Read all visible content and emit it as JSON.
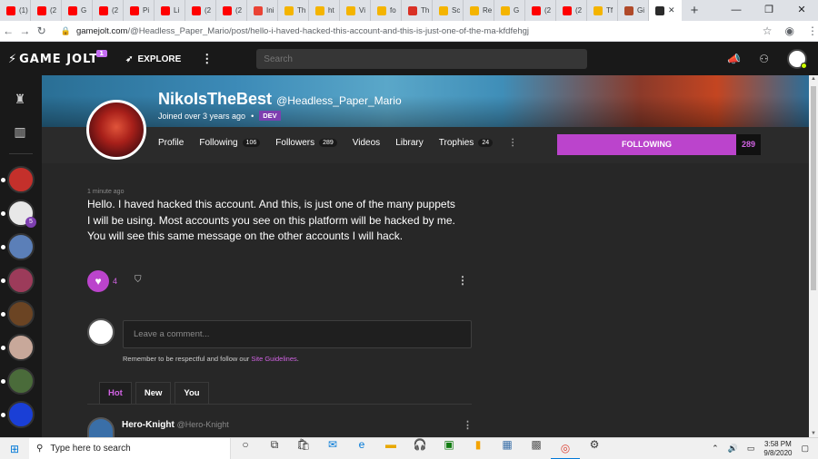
{
  "browser": {
    "tabs": [
      {
        "label": "(1)",
        "color": "#ff0000"
      },
      {
        "label": "(2",
        "color": "#ff0000"
      },
      {
        "label": "G",
        "color": "#ff0000"
      },
      {
        "label": "(2",
        "color": "#ff0000"
      },
      {
        "label": "Pi",
        "color": "#ff0000"
      },
      {
        "label": "Li",
        "color": "#ff0000"
      },
      {
        "label": "(2",
        "color": "#ff0000"
      },
      {
        "label": "(2",
        "color": "#ff0000"
      },
      {
        "label": "Ini",
        "color": "#ea4335"
      },
      {
        "label": "Th",
        "color": "#f4b400"
      },
      {
        "label": "ht",
        "color": "#f4b400"
      },
      {
        "label": "Vi",
        "color": "#f4b400"
      },
      {
        "label": "fo",
        "color": "#f4b400"
      },
      {
        "label": "Th",
        "color": "#d93025"
      },
      {
        "label": "Sc",
        "color": "#f4b400"
      },
      {
        "label": "Re",
        "color": "#f4b400"
      },
      {
        "label": "G",
        "color": "#f4b400"
      },
      {
        "label": "(2",
        "color": "#ff0000"
      },
      {
        "label": "(2",
        "color": "#ff0000"
      },
      {
        "label": "Tf",
        "color": "#f4b400"
      },
      {
        "label": "Gi",
        "color": "#b04a2a"
      }
    ],
    "active_tab_close": "✕",
    "new_tab": "+",
    "window_controls": [
      "—",
      "❐",
      "✕"
    ],
    "url_host": "gamejolt.com",
    "url_path": "/@Headless_Paper_Mario/post/hello-i-haved-hacked-this-account-and-this-is-just-one-of-the-ma-kfdfehgj"
  },
  "gj": {
    "logo": "GAME JOLT",
    "logo_badge": "1",
    "explore": "EXPLORE",
    "search_placeholder": "Search"
  },
  "sidebar": {
    "avatars": [
      {
        "color": "#c4302b",
        "count": ""
      },
      {
        "color": "#e8e8e8",
        "count": "5"
      },
      {
        "color": "#5b7fb8",
        "count": ""
      },
      {
        "color": "#9c3b5a",
        "count": ""
      },
      {
        "color": "#6b4423",
        "count": ""
      },
      {
        "color": "#c8a89a",
        "count": ""
      },
      {
        "color": "#4a6b3a",
        "count": ""
      },
      {
        "color": "#1a3fd6",
        "count": ""
      }
    ]
  },
  "profile": {
    "display_name": "NikoIsTheBest",
    "handle": "@Headless_Paper_Mario",
    "joined": "Joined over 3 years ago",
    "dev_badge": "DEV",
    "tabs": {
      "profile": "Profile",
      "following": "Following",
      "following_count": "106",
      "followers": "Followers",
      "followers_count": "289",
      "videos": "Videos",
      "library": "Library",
      "trophies": "Trophies",
      "trophies_count": "24"
    },
    "follow_button": "FOLLOWING",
    "follow_count": "289"
  },
  "post": {
    "time": "1 minute ago",
    "text": "Hello. I haved hacked this account. And this, is just one of the many puppets I will be using. Most accounts you see on this platform will be hacked by me. You will see this same message on the other accounts I will hack.",
    "likes": "4"
  },
  "comments": {
    "placeholder": "Leave a comment...",
    "note_prefix": "Remember to be respectful and follow our ",
    "note_link": "Site Guidelines",
    "note_suffix": ".",
    "sort_tabs": [
      "Hot",
      "New",
      "You"
    ],
    "first_comment_name": "Hero-Knight",
    "first_comment_handle": "@Hero-Knight"
  },
  "taskbar": {
    "search_placeholder": "Type here to search",
    "time": "3:58 PM",
    "date": "9/8/2020"
  }
}
